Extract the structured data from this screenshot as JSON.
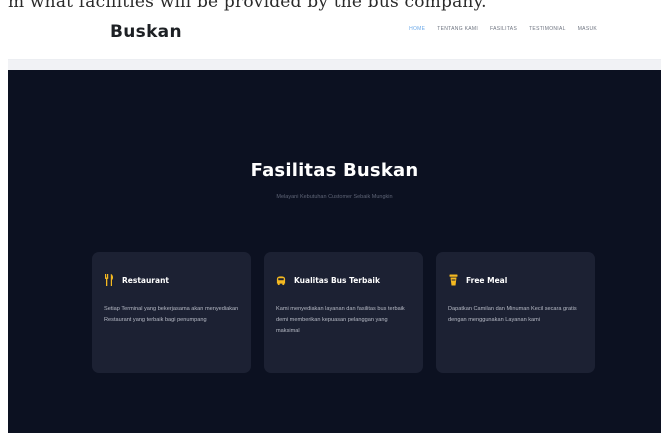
{
  "caption": "m what facilities will be provided by the bus company.",
  "header": {
    "logo": "Buskan",
    "nav": [
      {
        "label": "HOME",
        "active": true
      },
      {
        "label": "TENTANG KAMI",
        "active": false
      },
      {
        "label": "FASILITAS",
        "active": false
      },
      {
        "label": "TESTIMONIAL",
        "active": false
      },
      {
        "label": "MASUK",
        "active": false
      }
    ]
  },
  "facilities": {
    "title": "Fasilitas Buskan",
    "subtitle": "Melayani Kebutuhan Customer Sebaik Mungkin",
    "cards": [
      {
        "icon": "restaurant-icon",
        "title": "Restaurant",
        "description": "Setiap Terminal yang bekerjasama akan menyediakan Restaurant yang terbaik bagi penumpang"
      },
      {
        "icon": "bus-icon",
        "title": "Kualitas Bus Terbaik",
        "description": "Kami menyediakan layanan dan fasilitas bus terbaik demi memberikan kepuasan pelanggan yang maksimal"
      },
      {
        "icon": "meal-icon",
        "title": "Free Meal",
        "description": "Dapatkan Camilan dan Minuman Kecil secara gratis dengan menggunakan Layanan kami"
      }
    ]
  },
  "colors": {
    "section_background": "#0c1121",
    "card_background": "#1c2133",
    "icon_accent": "#f5b920",
    "nav_active": "#6aa8e8"
  }
}
